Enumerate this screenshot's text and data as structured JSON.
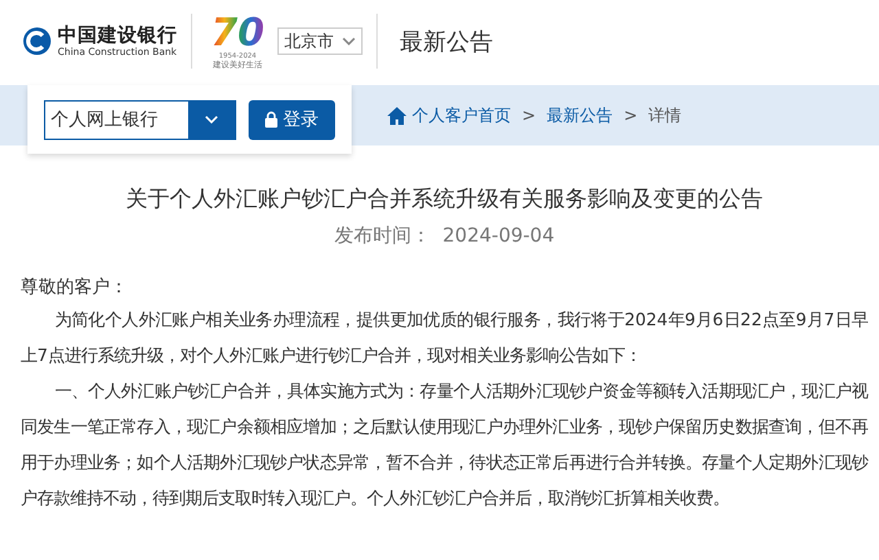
{
  "header": {
    "logo_cn": "中国建设银行",
    "logo_en": "China Construction Bank",
    "anniversary": {
      "mark": "70",
      "years": "1954-2024",
      "slogan": "建设美好生活"
    },
    "city_select": {
      "value": "北京市"
    },
    "section_title": "最新公告"
  },
  "login": {
    "channel_select": {
      "value": "个人网上银行"
    },
    "button": "登录"
  },
  "breadcrumb": [
    {
      "label": "个人客户首页",
      "kind": "home"
    },
    {
      "label": "最新公告",
      "kind": "link"
    },
    {
      "label": "详情",
      "kind": "current"
    }
  ],
  "breadcrumb_separator": ">",
  "article": {
    "title": "关于个人外汇账户钞汇户合并系统升级有关服务影响及变更的公告",
    "date": "发布时间：  2024-09-04",
    "greeting": "尊敬的客户：",
    "paragraphs": [
      "为简化个人外汇账户相关业务办理流程，提供更加优质的银行服务，我行将于2024年9月6日22点至9月7日早上7点进行系统升级，对个人外汇账户进行钞汇户合并，现对相关业务影响公告如下：",
      "一、个人外汇账户钞汇户合并，具体实施方式为：存量个人活期外汇现钞户资金等额转入活期现汇户，现汇户视同发生一笔正常存入，现汇户余额相应增加；之后默认使用现汇户办理外汇业务，现钞户保留历史数据查询，但不再用于办理业务；如个人活期外汇现钞户状态异常，暂不合并，待状态正常后再进行合并转换。存量个人定期外汇现钞户存款维持不动，待到期后支取时转入现汇户。个人外汇钞汇户合并后，取消钞汇折算相关收费。"
    ]
  }
}
